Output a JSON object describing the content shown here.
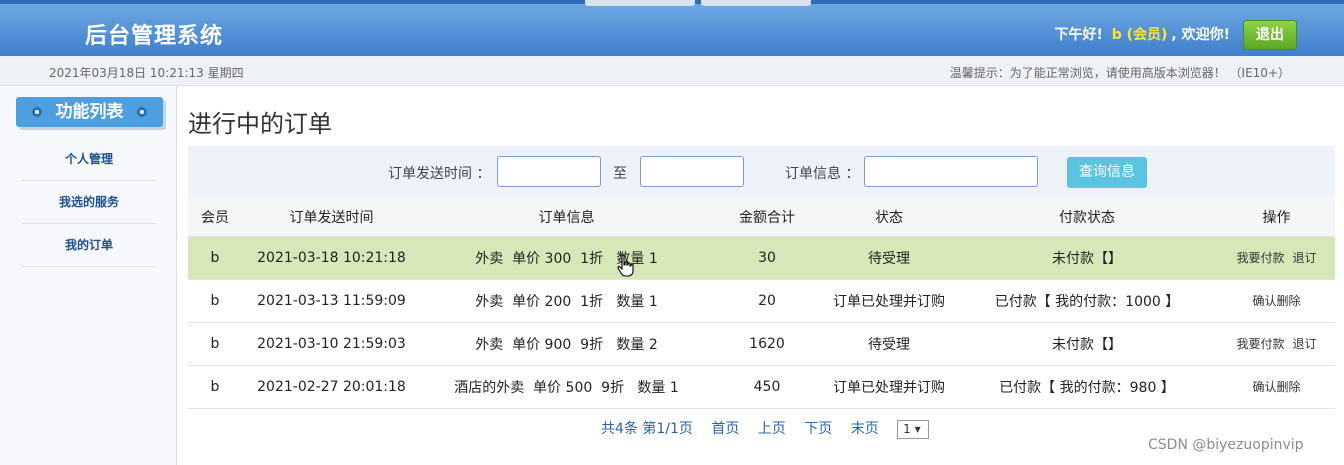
{
  "app": {
    "title": "后台管理系统",
    "greeting_prefix": "下午好!",
    "username": "b (会员)",
    "greeting_suffix": ", 欢迎你!",
    "logout_label": "退出",
    "datetime": "2021年03月18日 10:21:13 星期四",
    "tip": "温馨提示：为了能正常浏览，请使用高版本浏览器！ （IE10+）"
  },
  "sidebar": {
    "header": "功能列表",
    "items": [
      {
        "label": "个人管理"
      },
      {
        "label": "我选的服务"
      },
      {
        "label": "我的订单"
      }
    ]
  },
  "main": {
    "page_title": "进行中的订单",
    "search": {
      "time_label": "订单发送时间 ：",
      "to_label": "至",
      "start_value": "",
      "end_value": "",
      "info_label": "订单信息 ：",
      "info_value": "",
      "search_button": "查询信息"
    },
    "table": {
      "headers": [
        "会员",
        "订单发送时间",
        "订单信息",
        "金额合计",
        "状态",
        "付款状态",
        "操作"
      ],
      "rows": [
        {
          "member": "b",
          "time": "2021-03-18 10:21:18",
          "info": "外卖  单价 300  1折   数量 1",
          "total": "30",
          "status": "待受理",
          "pay_status": "未付款【】",
          "actions": [
            "我要付款",
            "退订"
          ]
        },
        {
          "member": "b",
          "time": "2021-03-13 11:59:09",
          "info": "外卖  单价 200  1折   数量 1",
          "total": "20",
          "status": "订单已处理并订购",
          "pay_status": "已付款【 我的付款：1000 】",
          "actions": [
            "确认删除"
          ]
        },
        {
          "member": "b",
          "time": "2021-03-10 21:59:03",
          "info": "外卖  单价 900  9折   数量 2",
          "total": "1620",
          "status": "待受理",
          "pay_status": "未付款【】",
          "actions": [
            "我要付款",
            "退订"
          ]
        },
        {
          "member": "b",
          "time": "2021-02-27 20:01:18",
          "info": "酒店的外卖  单价 500  9折   数量 1",
          "total": "450",
          "status": "订单已处理并订购",
          "pay_status": "已付款【 我的付款：980 】",
          "actions": [
            "确认删除"
          ]
        }
      ]
    },
    "pager": {
      "summary": "共4条  第1/1页",
      "first": "首页",
      "prev": "上页",
      "next": "下页",
      "last": "末页",
      "page_select": "1 ▾"
    }
  },
  "watermark": "CSDN @biyezuopinvip"
}
